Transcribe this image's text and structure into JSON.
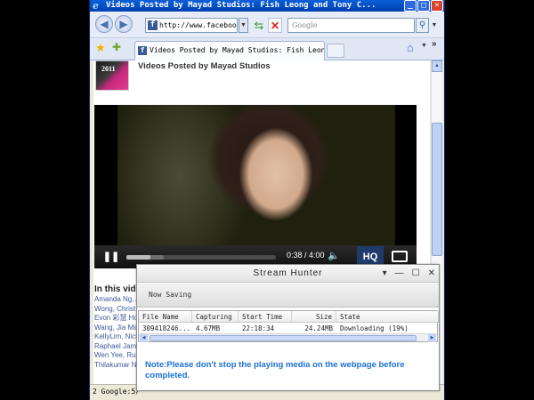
{
  "ie": {
    "title": "Videos Posted by Mayad Studios: Fish Leong and Tony C...",
    "address": "http://www.facebook.",
    "search_placeholder": "Google",
    "tab_title": "Videos Posted by Mayad Studios: Fish Leon..."
  },
  "page": {
    "avatar_text": "2011",
    "heading": "Videos Posted by Mayad Studios",
    "video": {
      "time": "0:38 / 4:00",
      "hq_label": "HQ",
      "progress": 0.158,
      "buffered": 0.25
    },
    "in_this_video": "In this video",
    "tags": [
      "Amanda Ng, A",
      "Wong, Christ",
      "Evon 彩慧  Ho",
      "Wang, Jia Min",
      "KellyLim, Nich",
      "Raphael Jamil",
      "Wen Yee, Rui",
      "Thilakumar Na"
    ]
  },
  "statusbar": {
    "text": "2  Google:5/"
  },
  "stream_hunter": {
    "title": "Stream Hunter",
    "now_saving": "Now Saving",
    "columns": [
      "File Name",
      "Capturing",
      "Start Time",
      "Size",
      "State"
    ],
    "rows": [
      {
        "file_name": "309418246...",
        "capturing": "4.67MB",
        "start_time": "22:18:34",
        "size": "24.24MB",
        "state": "Downloading (19%)"
      }
    ],
    "note": "Note:Please don't stop the playing media on the webpage before completed."
  }
}
